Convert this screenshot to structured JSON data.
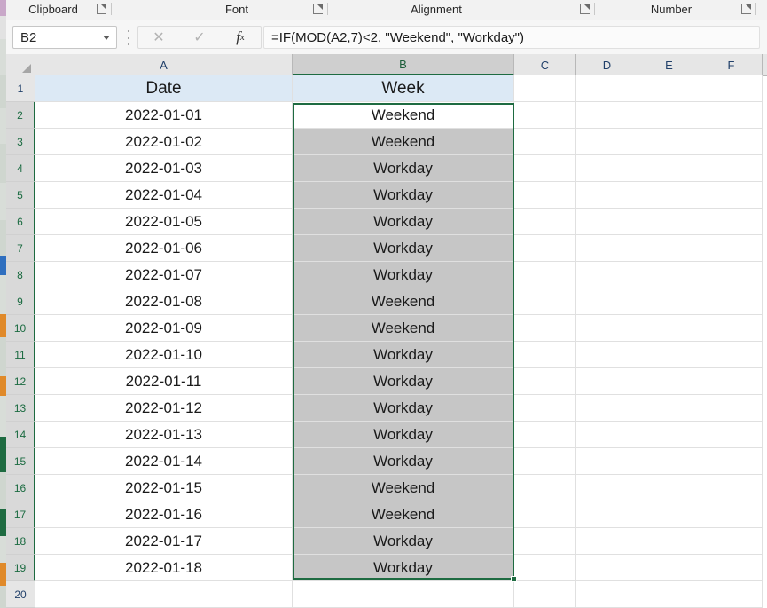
{
  "application": "Microsoft Excel",
  "ribbon": {
    "groups": [
      {
        "label": "Clipboard",
        "launcher": "dialog-launcher-icon"
      },
      {
        "label": "Font",
        "launcher": "dialog-launcher-icon"
      },
      {
        "label": "Alignment",
        "launcher": "dialog-launcher-icon"
      },
      {
        "label": "Number",
        "launcher": "dialog-launcher-icon"
      }
    ]
  },
  "formula_bar": {
    "name_box_value": "B2",
    "name_box_dropdown_icon": "chevron-down-icon",
    "cancel_icon": "close-icon",
    "enter_icon": "check-icon",
    "insert_function_icon": "fx-icon",
    "insert_function_label": "fx",
    "formula": "=IF(MOD(A2,7)<2, \"Weekend\", \"Workday\")"
  },
  "grid": {
    "select_all_icon": "select-all-triangle-icon",
    "columns": [
      {
        "letter": "A",
        "selected": false
      },
      {
        "letter": "B",
        "selected": true
      },
      {
        "letter": "C",
        "selected": false
      },
      {
        "letter": "D",
        "selected": false
      },
      {
        "letter": "E",
        "selected": false
      },
      {
        "letter": "F",
        "selected": false
      }
    ],
    "rows": [
      {
        "number": "1",
        "selected": false,
        "a": "Date",
        "b": "Week",
        "style": "header"
      },
      {
        "number": "2",
        "selected": true,
        "a": "2022-01-01",
        "b": "Weekend",
        "style": "active"
      },
      {
        "number": "3",
        "selected": true,
        "a": "2022-01-02",
        "b": "Weekend",
        "style": "selected"
      },
      {
        "number": "4",
        "selected": true,
        "a": "2022-01-03",
        "b": "Workday",
        "style": "selected"
      },
      {
        "number": "5",
        "selected": true,
        "a": "2022-01-04",
        "b": "Workday",
        "style": "selected"
      },
      {
        "number": "6",
        "selected": true,
        "a": "2022-01-05",
        "b": "Workday",
        "style": "selected"
      },
      {
        "number": "7",
        "selected": true,
        "a": "2022-01-06",
        "b": "Workday",
        "style": "selected"
      },
      {
        "number": "8",
        "selected": true,
        "a": "2022-01-07",
        "b": "Workday",
        "style": "selected"
      },
      {
        "number": "9",
        "selected": true,
        "a": "2022-01-08",
        "b": "Weekend",
        "style": "selected"
      },
      {
        "number": "10",
        "selected": true,
        "a": "2022-01-09",
        "b": "Weekend",
        "style": "selected"
      },
      {
        "number": "11",
        "selected": true,
        "a": "2022-01-10",
        "b": "Workday",
        "style": "selected"
      },
      {
        "number": "12",
        "selected": true,
        "a": "2022-01-11",
        "b": "Workday",
        "style": "selected"
      },
      {
        "number": "13",
        "selected": true,
        "a": "2022-01-12",
        "b": "Workday",
        "style": "selected"
      },
      {
        "number": "14",
        "selected": true,
        "a": "2022-01-13",
        "b": "Workday",
        "style": "selected"
      },
      {
        "number": "15",
        "selected": true,
        "a": "2022-01-14",
        "b": "Workday",
        "style": "selected"
      },
      {
        "number": "16",
        "selected": true,
        "a": "2022-01-15",
        "b": "Weekend",
        "style": "selected"
      },
      {
        "number": "17",
        "selected": true,
        "a": "2022-01-16",
        "b": "Weekend",
        "style": "selected"
      },
      {
        "number": "18",
        "selected": true,
        "a": "2022-01-17",
        "b": "Workday",
        "style": "selected"
      },
      {
        "number": "19",
        "selected": true,
        "a": "2022-01-18",
        "b": "Workday",
        "style": "selected"
      },
      {
        "number": "20",
        "selected": false,
        "a": "",
        "b": "",
        "style": "normal"
      }
    ],
    "selection_range": "B2:B19",
    "fill_handle_icon": "fill-handle-icon"
  },
  "colors": {
    "accent_green": "#1e6b41",
    "header_fill": "#dce9f5",
    "selection_fill": "#c6c6c6",
    "header_gray": "#e6e6e6"
  }
}
